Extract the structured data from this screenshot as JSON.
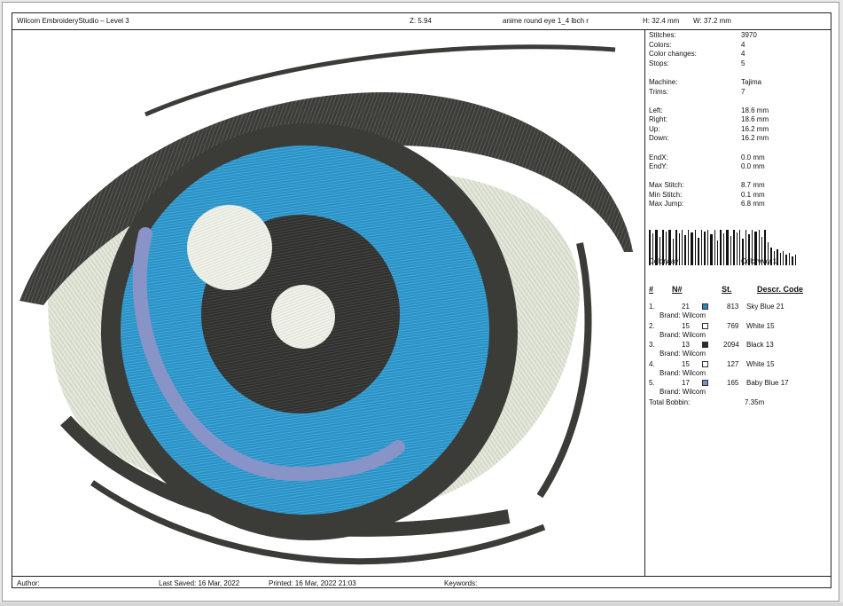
{
  "header": {
    "app": "Wilcom EmbroideryStudio – Level 3",
    "zoom": "Z: 5.94",
    "design_name": "anime round eye 1_4 lbch r",
    "height": "H: 32.4 mm",
    "width": "W: 37.2 mm"
  },
  "stats": [
    {
      "label": "Stitches:",
      "value": "3970"
    },
    {
      "label": "Colors:",
      "value": "4"
    },
    {
      "label": "Color changes:",
      "value": "4"
    },
    {
      "label": "Stops:",
      "value": "5"
    },
    {
      "label": "Machine:",
      "value": "Tajima"
    },
    {
      "label": "Trims:",
      "value": "7"
    },
    {
      "label": "Left:",
      "value": "18.6 mm"
    },
    {
      "label": "Right:",
      "value": "18.6 mm"
    },
    {
      "label": "Up:",
      "value": "16.2 mm"
    },
    {
      "label": "Down:",
      "value": "16.2 mm"
    },
    {
      "label": "EndX:",
      "value": "0.0 mm"
    },
    {
      "label": "EndY:",
      "value": "0.0 mm"
    },
    {
      "label": "Max Stitch:",
      "value": "8.7 mm"
    },
    {
      "label": "Min Stitch:",
      "value": "0.1 mm"
    },
    {
      "label": "Max Jump:",
      "value": "6.8 mm"
    }
  ],
  "colorway": {
    "label": "Colorway:",
    "value": "Colorway 1"
  },
  "thread_table": {
    "headers": {
      "num": "#",
      "n": "N#",
      "st": "St.",
      "desc": "Descr. Code"
    },
    "rows": [
      {
        "idx": "1.",
        "n": "21",
        "st": "813",
        "desc": "Sky Blue 21",
        "brand": "Brand: Wilcom",
        "color": "#2a86b8"
      },
      {
        "idx": "2.",
        "n": "15",
        "st": "769",
        "desc": "White 15",
        "brand": "Brand: Wilcom",
        "color": "#ffffff"
      },
      {
        "idx": "3.",
        "n": "13",
        "st": "2094",
        "desc": "Black 13",
        "brand": "Brand: Wilcom",
        "color": "#2b2b2b"
      },
      {
        "idx": "4.",
        "n": "15",
        "st": "127",
        "desc": "White 15",
        "brand": "Brand: Wilcom",
        "color": "#ffffff"
      },
      {
        "idx": "5.",
        "n": "17",
        "st": "165",
        "desc": "Baby Blue 17",
        "brand": "Brand: Wilcom",
        "color": "#7b8fcf"
      }
    ],
    "total_bobbin_label": "Total Bobbin:",
    "total_bobbin_value": "7.35m"
  },
  "footer": {
    "author": "Author:",
    "last_saved": "Last Saved: 16 Mar, 2022",
    "printed": "Printed: 16 Mar, 2022 21:03",
    "keywords": "Keywords:"
  },
  "colors": {
    "outline": "#3b3b38",
    "iris": "#2a8fc4",
    "iris_light": "#3aa6d6",
    "pupil": "#2f2f2d",
    "white": "#e3e8db",
    "highlight": "#f2f4ec",
    "baby_blue": "#8893c8"
  }
}
